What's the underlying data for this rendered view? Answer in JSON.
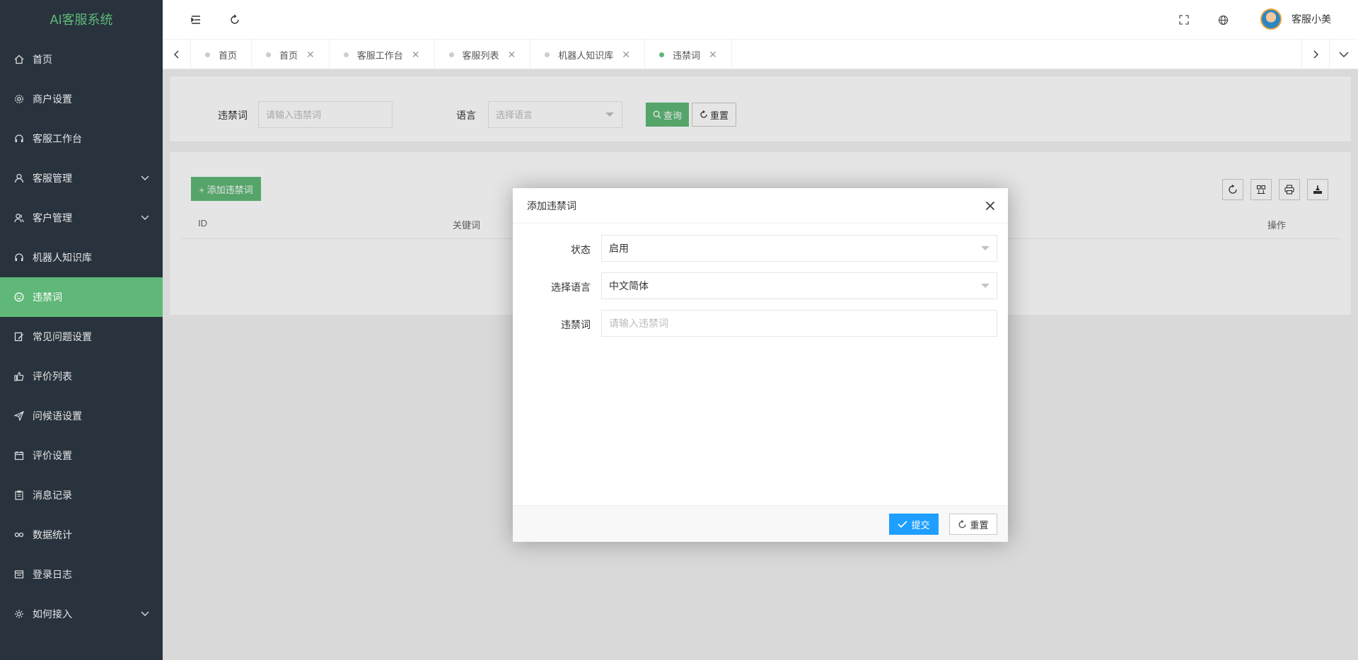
{
  "app": {
    "title": "AI客服系统"
  },
  "sidebar": {
    "items": [
      {
        "label": "首页",
        "icon": "home-icon"
      },
      {
        "label": "商户设置",
        "icon": "gear-icon"
      },
      {
        "label": "客服工作台",
        "icon": "headset-icon"
      },
      {
        "label": "客服管理",
        "icon": "user-icon",
        "expandable": true
      },
      {
        "label": "客户管理",
        "icon": "users-icon",
        "expandable": true
      },
      {
        "label": "机器人知识库",
        "icon": "robot-icon"
      },
      {
        "label": "违禁词",
        "icon": "smile-icon",
        "active": true
      },
      {
        "label": "常见问题设置",
        "icon": "edit-icon"
      },
      {
        "label": "评价列表",
        "icon": "thumb-up-icon"
      },
      {
        "label": "问候语设置",
        "icon": "send-icon"
      },
      {
        "label": "评价设置",
        "icon": "calendar-icon"
      },
      {
        "label": "消息记录",
        "icon": "clipboard-icon"
      },
      {
        "label": "数据统计",
        "icon": "link-icon"
      },
      {
        "label": "登录日志",
        "icon": "log-icon"
      },
      {
        "label": "如何接入",
        "icon": "plug-icon",
        "expandable": true
      }
    ],
    "colors": {
      "bg": "#28333e",
      "accent": "#5fb878"
    }
  },
  "header": {
    "username": "客服小美"
  },
  "tabs": [
    {
      "label": "首页",
      "closable": false
    },
    {
      "label": "首页",
      "closable": true
    },
    {
      "label": "客服工作台",
      "closable": true
    },
    {
      "label": "客服列表",
      "closable": true
    },
    {
      "label": "机器人知识库",
      "closable": true
    },
    {
      "label": "违禁词",
      "closable": true,
      "active": true
    }
  ],
  "search": {
    "keyword_label": "违禁词",
    "keyword_placeholder": "请输入违禁词",
    "language_label": "语言",
    "language_placeholder": "选择语言",
    "query_button": "查询",
    "reset_button": "重置"
  },
  "table": {
    "add_button": "+ 添加违禁词",
    "columns": [
      "ID",
      "关键词",
      "操作"
    ],
    "toolbar": [
      "refresh-icon",
      "columns-icon",
      "print-icon",
      "export-icon"
    ]
  },
  "modal": {
    "title": "添加违禁词",
    "fields": {
      "status_label": "状态",
      "status_value": "启用",
      "language_label": "选择语言",
      "language_value": "中文简体",
      "keyword_label": "违禁词",
      "keyword_placeholder": "请输入违禁词"
    },
    "submit_button": "提交",
    "reset_button": "重置",
    "colors": {
      "submit": "#1e9fff"
    }
  }
}
